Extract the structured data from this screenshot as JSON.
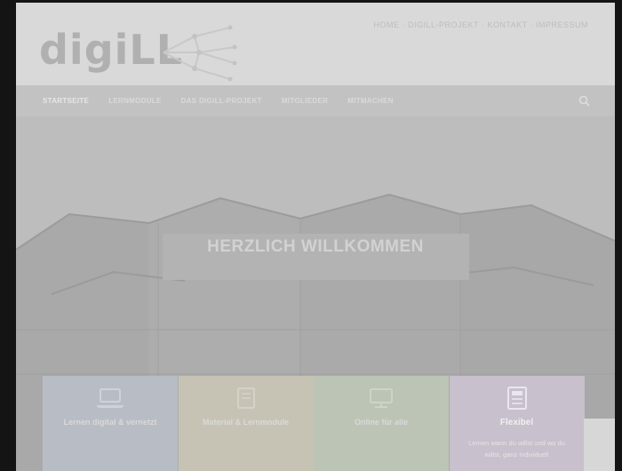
{
  "header": {
    "logo_text": "digiLL",
    "utility_links": "HOME · DIGILL-PROJEKT · KONTAKT · IMPRESSUM"
  },
  "nav": {
    "items": [
      {
        "label": "STARTSEITE",
        "active": true
      },
      {
        "label": "LERNMODULE",
        "active": false
      },
      {
        "label": "DAS DIGILL-PROJEKT",
        "active": false
      },
      {
        "label": "MITGLIEDER",
        "active": false
      },
      {
        "label": "MITMACHEN",
        "active": false
      }
    ]
  },
  "hero": {
    "title": "HERZLICH WILLKOMMEN"
  },
  "cards": [
    {
      "title": "Lernen digital & vernetzt",
      "text": "",
      "icon": "laptop-icon",
      "color": "#b8bcc4"
    },
    {
      "title": "Material & Lernmodule",
      "text": "",
      "icon": "book-icon",
      "color": "#c7c3b4"
    },
    {
      "title": "Online für alle",
      "text": "",
      "icon": "screen-icon",
      "color": "#bcc4b6"
    },
    {
      "title": "Flexibel",
      "text": "Lernen wann du willst und wo du willst, ganz individuell",
      "icon": "document-icon",
      "color": "#c8c0cc"
    }
  ]
}
